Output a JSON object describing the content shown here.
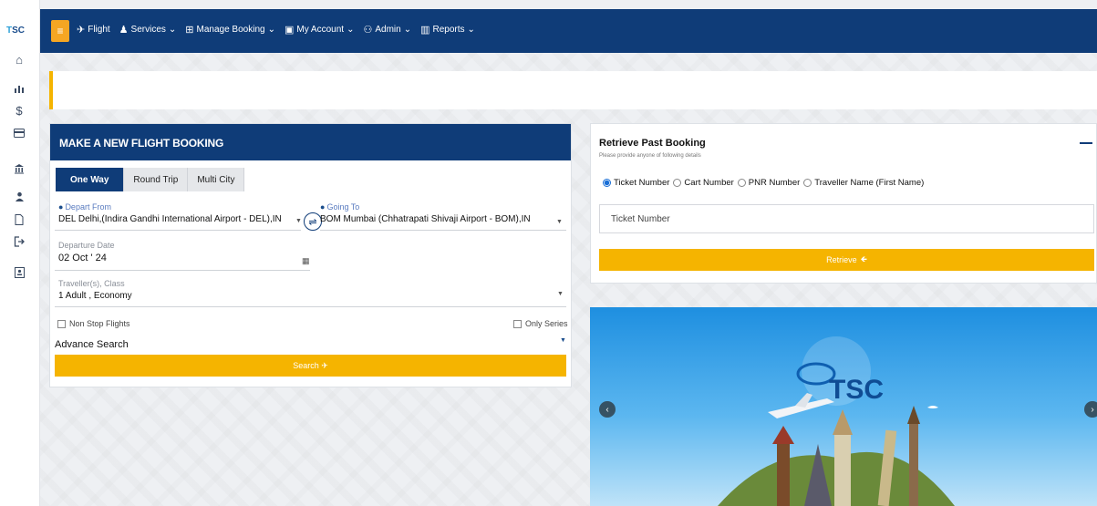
{
  "brand": {
    "rail_logo_a": "T",
    "rail_logo_b": "SC",
    "banner_logo": "TSC"
  },
  "rail_icons": [
    "home-icon",
    "chart-icon",
    "dollar-icon",
    "card-icon",
    "bank-icon",
    "user-icon",
    "document-icon",
    "logout-icon",
    "id-card-icon"
  ],
  "nav": {
    "flight": "Flight",
    "services": "Services",
    "manage_booking": "Manage Booking",
    "my_account": "My Account",
    "admin": "Admin",
    "reports": "Reports"
  },
  "booking": {
    "title": "MAKE A NEW FLIGHT BOOKING",
    "tabs": [
      "One Way",
      "Round Trip",
      "Multi City"
    ],
    "depart_label": "Depart From",
    "depart_value": "DEL Delhi,(Indira Gandhi International Airport - DEL),IN",
    "going_label": "Going To",
    "going_value": "BOM Mumbai (Chhatrapati Shivaji Airport - BOM),IN",
    "date_label": "Departure Date",
    "date_value": "02 Oct ' 24",
    "travellers_label": "Traveller(s), Class",
    "travellers_value": "1 Adult , Economy",
    "non_stop": "Non Stop Flights",
    "only_series": "Only Series",
    "advance_search": "Advance Search",
    "search_button": "Search"
  },
  "retrieve": {
    "title": "Retrieve Past Booking",
    "subtitle": "Please provide anyone of following details",
    "options": [
      "Ticket Number",
      "Cart Number",
      "PNR Number",
      "Traveller Name (First Name)"
    ],
    "selected": "Ticket Number",
    "input_placeholder": "Ticket Number",
    "button": "Retrieve"
  },
  "colors": {
    "navy": "#0f3c78",
    "accent": "#f5b400"
  }
}
